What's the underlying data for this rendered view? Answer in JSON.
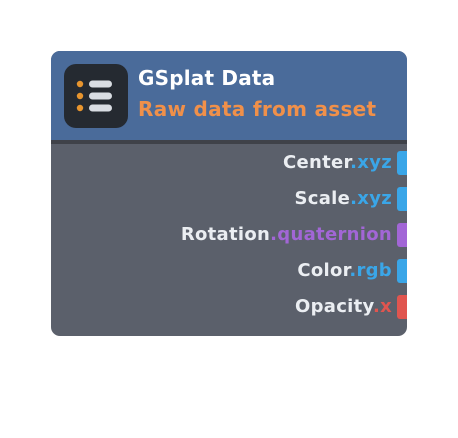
{
  "node": {
    "title": "GSplat Data",
    "subtitle": "Raw data from asset",
    "icon": "list-icon",
    "colors": {
      "header": "#4a6b9a",
      "body": "#5b606b",
      "subtitle": "#f0904a",
      "icon_bullet": "#e8952e",
      "icon_line": "#d9dde3"
    },
    "outputs": [
      {
        "name": "Center",
        "suffix": ".xyz",
        "color": "#3aa6e8"
      },
      {
        "name": "Scale",
        "suffix": ".xyz",
        "color": "#3aa6e8"
      },
      {
        "name": "Rotation",
        "suffix": ".quaternion",
        "color": "#a266d6"
      },
      {
        "name": "Color",
        "suffix": ".rgb",
        "color": "#3aa6e8"
      },
      {
        "name": "Opacity",
        "suffix": ".x",
        "color": "#e0554f"
      }
    ]
  }
}
